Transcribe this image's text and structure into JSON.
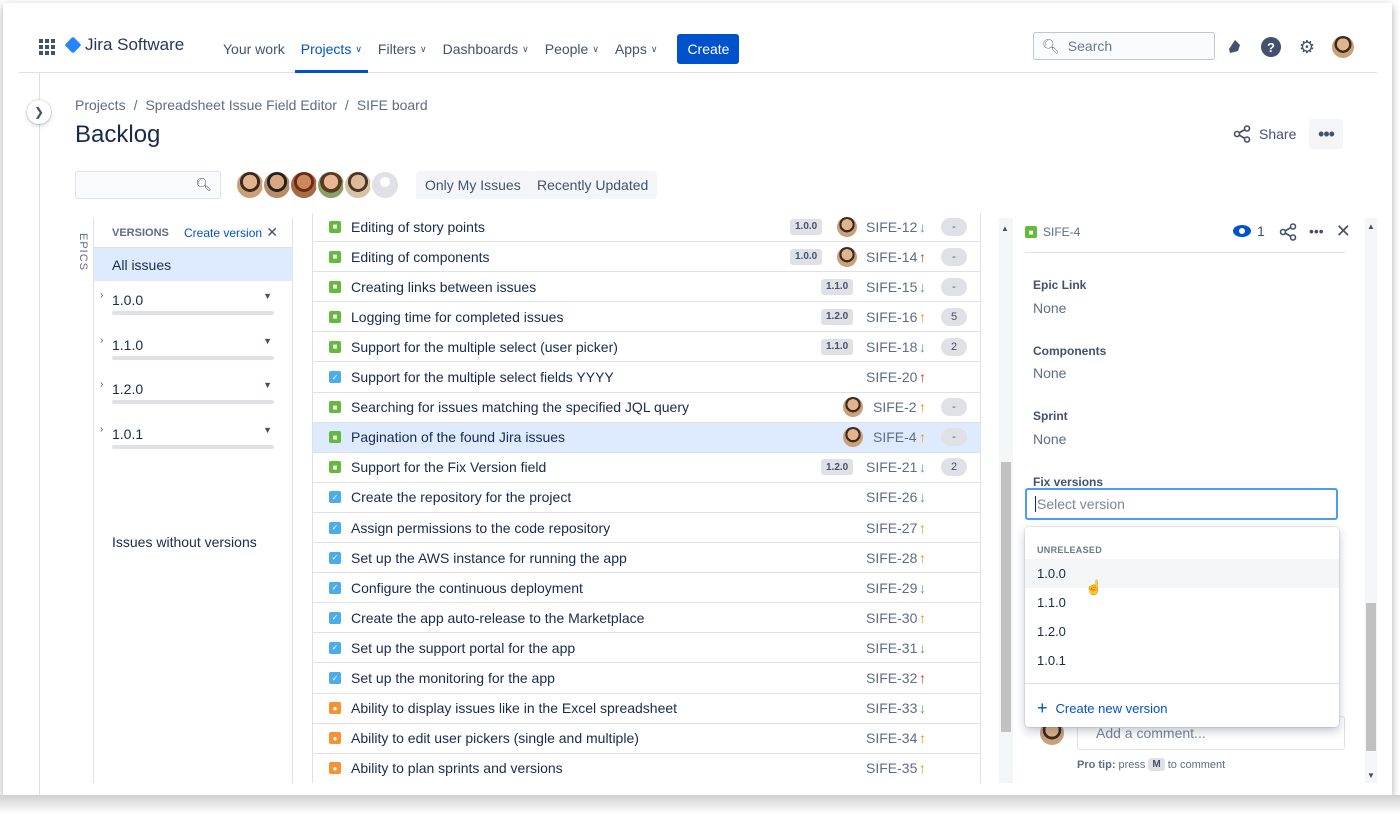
{
  "nav": {
    "product": "Jira Software",
    "items": [
      {
        "label": "Your work",
        "chevron": false,
        "active": false
      },
      {
        "label": "Projects",
        "chevron": true,
        "active": true
      },
      {
        "label": "Filters",
        "chevron": true,
        "active": false
      },
      {
        "label": "Dashboards",
        "chevron": true,
        "active": false
      },
      {
        "label": "People",
        "chevron": true,
        "active": false
      },
      {
        "label": "Apps",
        "chevron": true,
        "active": false
      }
    ],
    "create_label": "Create",
    "search_placeholder": "Search"
  },
  "breadcrumb": [
    "Projects",
    "Spreadsheet Issue Field Editor",
    "SIFE board"
  ],
  "breadcrumb_sep": "/",
  "page_title": "Backlog",
  "share_label": "Share",
  "quick_filters": [
    "Only My Issues",
    "Recently Updated"
  ],
  "epics_label": "EPICS",
  "versions_panel": {
    "header": "VERSIONS",
    "create_label": "Create version",
    "all_issues": "All issues",
    "versions": [
      "1.0.0",
      "1.1.0",
      "1.2.0",
      "1.0.1"
    ],
    "no_versions": "Issues without versions"
  },
  "issues": [
    {
      "type": "story",
      "summary": "Editing of story points",
      "version": "1.0.0",
      "avatar": true,
      "key": "SIFE-12",
      "priority": "down-green",
      "estimate": "-"
    },
    {
      "type": "story",
      "summary": "Editing of components",
      "version": "1.0.0",
      "avatar": true,
      "key": "SIFE-14",
      "priority": "up-red",
      "estimate": "-"
    },
    {
      "type": "story",
      "summary": "Creating links between issues",
      "version": "1.1.0",
      "avatar": false,
      "key": "SIFE-15",
      "priority": "down-green",
      "estimate": "-"
    },
    {
      "type": "story",
      "summary": "Logging time for completed issues",
      "version": "1.2.0",
      "avatar": false,
      "key": "SIFE-16",
      "priority": "up-orange",
      "estimate": "5"
    },
    {
      "type": "story",
      "summary": "Support for the multiple select (user picker)",
      "version": "1.1.0",
      "avatar": false,
      "key": "SIFE-18",
      "priority": "down-green",
      "estimate": "2"
    },
    {
      "type": "task",
      "summary": "Support for the multiple select fields YYYY",
      "version": "",
      "avatar": false,
      "key": "SIFE-20",
      "priority": "up-red",
      "estimate": ""
    },
    {
      "type": "story",
      "summary": "Searching for issues matching the specified JQL query",
      "version": "",
      "avatar": true,
      "key": "SIFE-2",
      "priority": "up-orange",
      "estimate": "-"
    },
    {
      "type": "story",
      "summary": "Pagination of the found Jira issues",
      "version": "",
      "avatar": true,
      "key": "SIFE-4",
      "priority": "up-orange",
      "estimate": "-",
      "selected": true
    },
    {
      "type": "story",
      "summary": "Support for the Fix Version field",
      "version": "1.2.0",
      "avatar": false,
      "key": "SIFE-21",
      "priority": "down-green",
      "estimate": "2"
    },
    {
      "type": "task",
      "summary": "Create the repository for the project",
      "version": "",
      "avatar": false,
      "key": "SIFE-26",
      "priority": "down-green",
      "estimate": ""
    },
    {
      "type": "task",
      "summary": "Assign permissions to the code repository",
      "version": "",
      "avatar": false,
      "key": "SIFE-27",
      "priority": "up-orange",
      "estimate": ""
    },
    {
      "type": "task",
      "summary": "Set up the AWS instance for running the app",
      "version": "",
      "avatar": false,
      "key": "SIFE-28",
      "priority": "up-orange",
      "estimate": ""
    },
    {
      "type": "task",
      "summary": "Configure the continuous deployment",
      "version": "",
      "avatar": false,
      "key": "SIFE-29",
      "priority": "down-green",
      "estimate": ""
    },
    {
      "type": "task",
      "summary": "Create the app auto-release to the Marketplace",
      "version": "",
      "avatar": false,
      "key": "SIFE-30",
      "priority": "up-orange",
      "estimate": ""
    },
    {
      "type": "task",
      "summary": "Set up the support portal for the app",
      "version": "",
      "avatar": false,
      "key": "SIFE-31",
      "priority": "down-green",
      "estimate": ""
    },
    {
      "type": "task",
      "summary": "Set up the monitoring for the app",
      "version": "",
      "avatar": false,
      "key": "SIFE-32",
      "priority": "up-red",
      "estimate": ""
    },
    {
      "type": "improvement",
      "summary": "Ability to display issues like in the Excel spreadsheet",
      "version": "",
      "avatar": false,
      "key": "SIFE-33",
      "priority": "down-green",
      "estimate": ""
    },
    {
      "type": "improvement",
      "summary": "Ability to edit user pickers (single and multiple)",
      "version": "",
      "avatar": false,
      "key": "SIFE-34",
      "priority": "up-orange",
      "estimate": ""
    },
    {
      "type": "improvement",
      "summary": "Ability to plan sprints and versions",
      "version": "",
      "avatar": false,
      "key": "SIFE-35",
      "priority": "up-orange",
      "estimate": ""
    }
  ],
  "detail": {
    "key": "SIFE-4",
    "watchers": "1",
    "fields": [
      {
        "label": "Epic Link",
        "value": "None"
      },
      {
        "label": "Components",
        "value": "None"
      },
      {
        "label": "Sprint",
        "value": "None"
      }
    ],
    "fix_versions_label": "Fix versions",
    "select_placeholder": "Select version",
    "dropdown_group": "UNRELEASED",
    "dropdown_options": [
      "1.0.0",
      "1.1.0",
      "1.2.0",
      "1.0.1"
    ],
    "create_new_version": "Create new version",
    "comment_placeholder": "Add a comment...",
    "protip_prefix": "Pro tip:",
    "protip_press": "press",
    "protip_key": "M",
    "protip_suffix": "to comment"
  },
  "colors": {
    "accent": "#0052cc",
    "selected_row": "#deebff",
    "story": "#63ba3c",
    "task": "#4bade8",
    "improvement": "#f79232",
    "priority_red": "#de350b",
    "priority_orange": "#ff8b00",
    "priority_green": "#36b37e"
  }
}
